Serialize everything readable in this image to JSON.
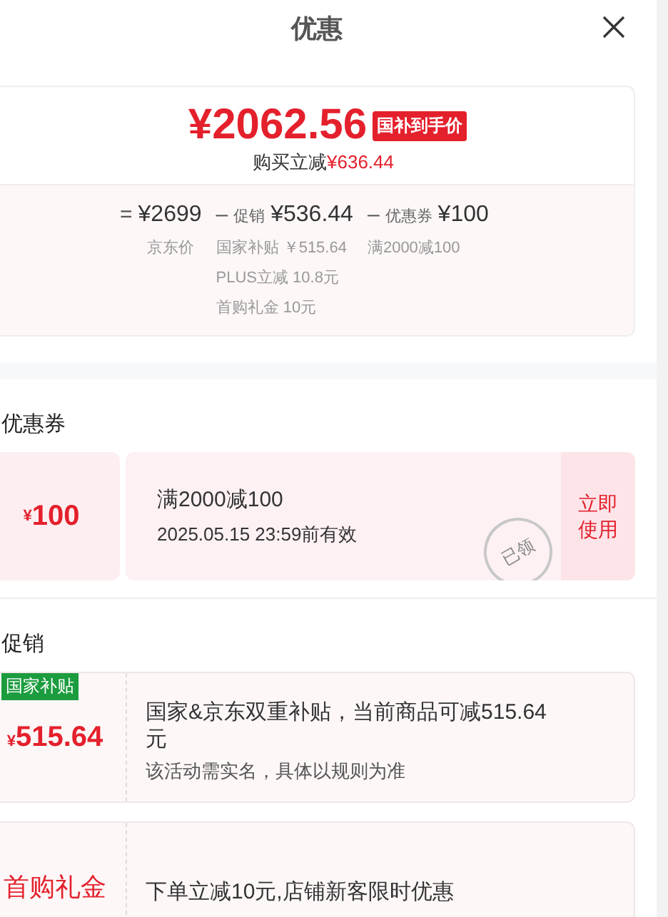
{
  "header": {
    "title": "优惠"
  },
  "summary": {
    "price": "¥2062.56",
    "badge": "国补到手价",
    "saving_label": "购买立减",
    "saving_amount": "¥636.44",
    "breakdown": [
      {
        "operator": "=",
        "amount": "¥2699",
        "details": [
          "京东价"
        ]
      },
      {
        "operator": "–",
        "label": "促销",
        "amount": "¥536.44",
        "details": [
          "国家补贴 ￥515.64",
          "PLUS立减 10.8元",
          "首购礼金 10元"
        ]
      },
      {
        "operator": "–",
        "label": "优惠券",
        "amount": "¥100",
        "details": [
          "满2000减100"
        ]
      }
    ]
  },
  "coupons": {
    "title": "优惠券",
    "items": [
      {
        "currency": "¥",
        "value": "100",
        "condition": "满2000减100",
        "validity": "2025.05.15 23:59前有效",
        "action": "立即使用",
        "stamp": "已领"
      }
    ]
  },
  "promotions": {
    "title": "促销",
    "items": [
      {
        "kind": "amount",
        "tag": "国家补贴",
        "currency": "¥",
        "value": "515.64",
        "description": "国家&京东双重补贴，当前商品可减515.64元",
        "note": "该活动需实名，具体以规则为准"
      },
      {
        "kind": "label",
        "label": "首购礼金",
        "description": "下单立减10元,店铺新客限时优惠"
      }
    ]
  }
}
